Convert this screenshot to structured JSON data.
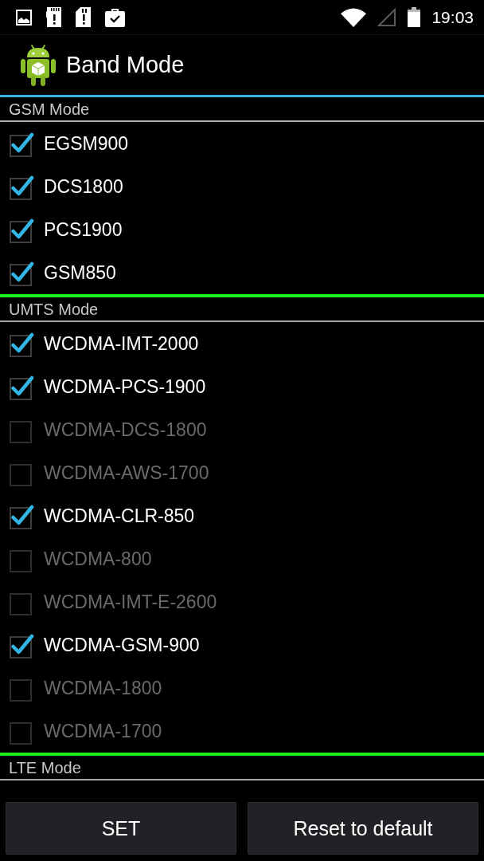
{
  "status_bar": {
    "time": "19:03"
  },
  "action_bar": {
    "title": "Band Mode"
  },
  "sections": [
    {
      "title": "GSM Mode",
      "bands": [
        {
          "label": "EGSM900",
          "checked": true,
          "disabled": false
        },
        {
          "label": "DCS1800",
          "checked": true,
          "disabled": false
        },
        {
          "label": "PCS1900",
          "checked": true,
          "disabled": false
        },
        {
          "label": "GSM850",
          "checked": true,
          "disabled": false
        }
      ]
    },
    {
      "title": "UMTS Mode",
      "bands": [
        {
          "label": "WCDMA-IMT-2000",
          "checked": true,
          "disabled": false
        },
        {
          "label": "WCDMA-PCS-1900",
          "checked": true,
          "disabled": false
        },
        {
          "label": "WCDMA-DCS-1800",
          "checked": false,
          "disabled": true
        },
        {
          "label": "WCDMA-AWS-1700",
          "checked": false,
          "disabled": true
        },
        {
          "label": "WCDMA-CLR-850",
          "checked": true,
          "disabled": false
        },
        {
          "label": "WCDMA-800",
          "checked": false,
          "disabled": true
        },
        {
          "label": "WCDMA-IMT-E-2600",
          "checked": false,
          "disabled": true
        },
        {
          "label": "WCDMA-GSM-900",
          "checked": true,
          "disabled": false
        },
        {
          "label": "WCDMA-1800",
          "checked": false,
          "disabled": true
        },
        {
          "label": "WCDMA-1700",
          "checked": false,
          "disabled": true
        }
      ]
    },
    {
      "title": "LTE Mode"
    }
  ],
  "buttons": [
    {
      "label": "SET"
    },
    {
      "label": "Reset to default"
    }
  ]
}
